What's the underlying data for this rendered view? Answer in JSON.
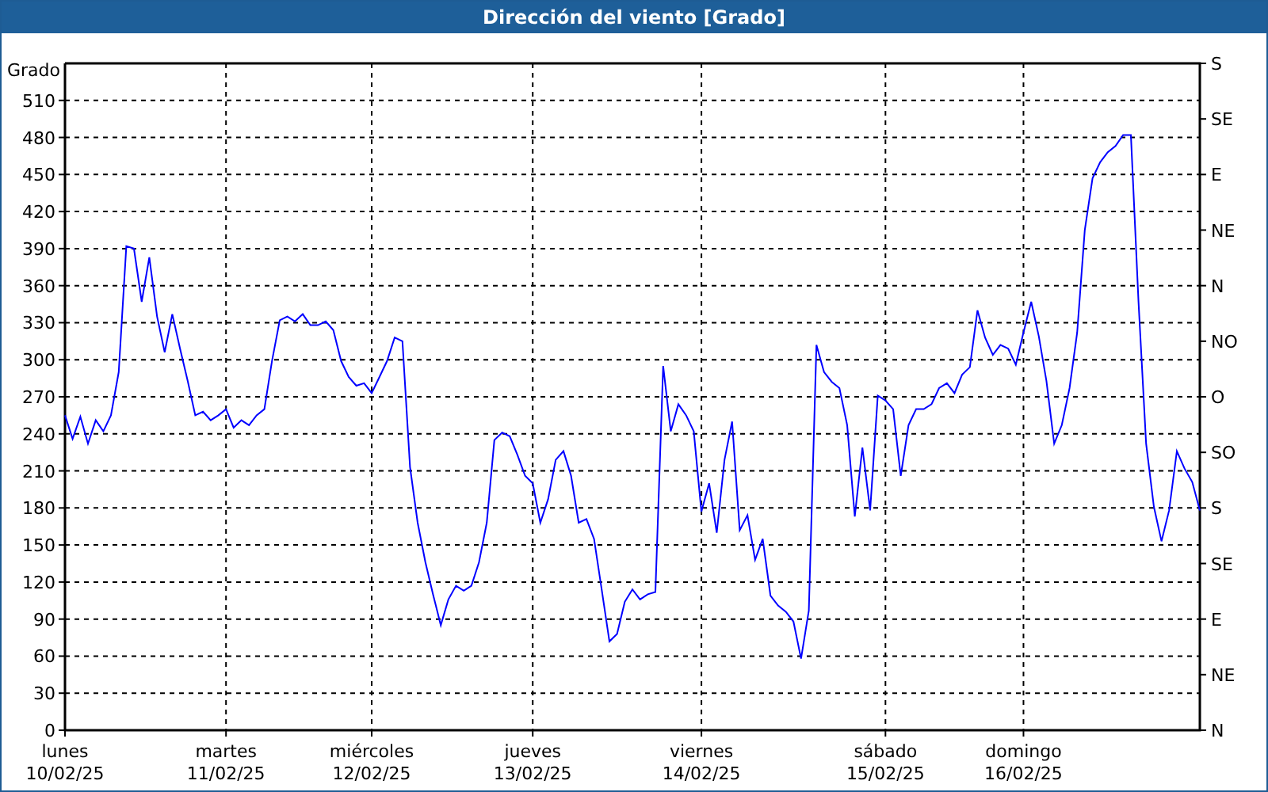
{
  "window": {
    "title": "Dirección del viento [Grado]"
  },
  "chart": {
    "chart_data": {
      "type": "line",
      "ylabel": "Grado",
      "ylim": [
        0,
        540
      ],
      "grid": true,
      "categories": [
        "10/02/25",
        null,
        null,
        null,
        null,
        null,
        null,
        null,
        null,
        null,
        null,
        null,
        null,
        null,
        null,
        null,
        null,
        null,
        null,
        null,
        null,
        "11/02/25",
        null,
        null,
        null,
        null,
        null,
        null,
        null,
        null,
        null,
        null,
        null,
        null,
        null,
        null,
        null,
        null,
        null,
        null,
        "12/02/25",
        null,
        null,
        null,
        null,
        null,
        null,
        null,
        null,
        null,
        null,
        null,
        null,
        null,
        null,
        null,
        null,
        null,
        null,
        null,
        null,
        "13/02/25",
        null,
        null,
        null,
        null,
        null,
        null,
        null,
        null,
        null,
        null,
        null,
        null,
        null,
        null,
        null,
        null,
        null,
        null,
        null,
        null,
        null,
        "14/02/25",
        null,
        null,
        null,
        null,
        null,
        null,
        null,
        null,
        null,
        null,
        null,
        null,
        null,
        null,
        null,
        null,
        null,
        null,
        null,
        null,
        null,
        null,
        null,
        "15/02/25",
        null,
        null,
        null,
        null,
        null,
        null,
        null,
        null,
        null,
        null,
        null,
        null,
        null,
        null,
        null,
        null,
        null,
        "16/02/25",
        null,
        null,
        null,
        null,
        null,
        null,
        null,
        null,
        null,
        null,
        null,
        null,
        null,
        null,
        null,
        null,
        null,
        null,
        null,
        null,
        null,
        null,
        null
      ],
      "yticks": [
        0,
        30,
        60,
        90,
        120,
        150,
        180,
        210,
        240,
        270,
        300,
        330,
        360,
        390,
        420,
        450,
        480,
        510
      ],
      "series": [
        {
          "color": "#0000ff",
          "values": [
            255,
            236,
            254,
            232,
            251,
            242,
            255,
            290,
            392,
            390,
            347,
            383,
            335,
            306,
            337,
            309,
            283,
            255,
            258,
            251,
            255,
            260,
            245,
            251,
            247,
            255,
            260,
            299,
            332,
            335,
            331,
            337,
            328,
            328,
            331,
            324,
            299,
            286,
            279,
            281,
            273,
            286,
            299,
            318,
            315,
            213,
            168,
            136,
            110,
            85,
            106,
            117,
            113,
            117,
            136,
            168,
            235,
            241,
            238,
            223,
            206,
            200,
            168,
            187,
            219,
            226,
            206,
            168,
            171,
            155,
            114,
            72,
            78,
            104,
            114,
            106,
            110,
            112,
            295,
            242,
            264,
            255,
            242,
            177,
            200,
            160,
            219,
            250,
            162,
            174,
            138,
            155,
            109,
            101,
            96,
            88,
            58,
            97,
            312,
            290,
            282,
            277,
            247,
            173,
            229,
            178,
            271,
            267,
            260,
            206,
            247,
            260,
            260,
            264,
            277,
            281,
            273,
            288,
            294,
            340,
            318,
            304,
            312,
            309,
            296,
            322,
            347,
            319,
            283,
            232,
            247,
            277,
            322,
            405,
            447,
            460,
            468,
            473,
            482,
            482,
            347,
            232,
            181,
            153,
            178,
            226,
            212,
            201,
            178
          ]
        }
      ]
    },
    "day_names": [
      "lunes",
      "martes",
      "miércoles",
      "jueves",
      "viernes",
      "sábado",
      "domingo"
    ],
    "right_axis_labels": [
      "S",
      "SE",
      "E",
      "NE",
      "N",
      "NO",
      "O",
      "SO",
      "S",
      "SE",
      "E",
      "NE",
      "N"
    ]
  }
}
